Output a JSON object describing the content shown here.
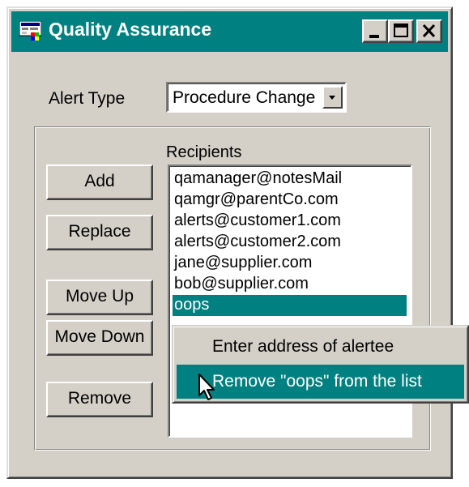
{
  "window": {
    "title": "Quality Assurance",
    "title_bar_color": "#008080",
    "controls": [
      "minimize-icon",
      "maximize-icon",
      "close-icon"
    ]
  },
  "alert_type": {
    "label": "Alert Type",
    "value": "Procedure Change"
  },
  "recipients": {
    "label": "Recipients",
    "items": [
      "qamanager@notesMail",
      "qamgr@parentCo.com",
      "alerts@customer1.com",
      "alerts@customer2.com",
      "jane@supplier.com",
      "bob@supplier.com",
      "oops"
    ],
    "selected_index": 6
  },
  "buttons": {
    "add": "Add",
    "replace": "Replace",
    "move_up": "Move Up",
    "move_down": "Move Down",
    "remove": "Remove"
  },
  "context_menu": {
    "items": [
      "Enter address of alertee",
      "Remove \"oops\" from the list"
    ],
    "highlighted_index": 1
  }
}
